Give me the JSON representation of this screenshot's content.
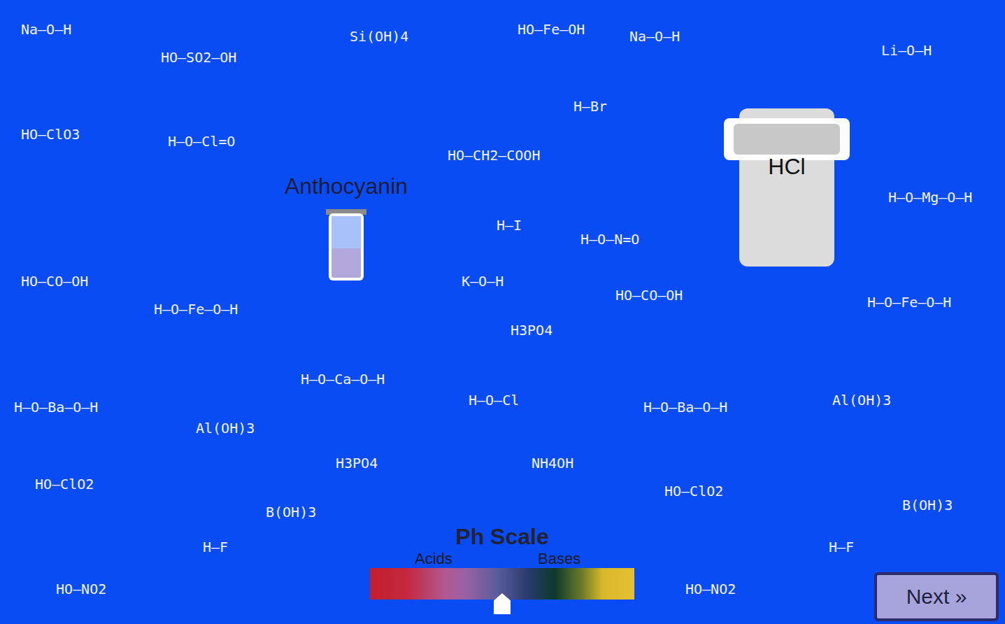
{
  "background_molecules": [
    "Na–O–H",
    "HO–SO2–OH",
    "Si(OH)4",
    "HO–Fe–OH",
    "Na–O–H",
    "Li–O–H",
    "HO–ClO3",
    "H–O–Cl=O",
    "HO–CH2–COOH",
    "H–Br",
    "H–I",
    "H–O–N=O",
    "HO–CO–OH",
    "H–O–Fe–O–H",
    "K–O–H",
    "H3PO4",
    "HO–CO–OH",
    "H–O–Fe–O–H",
    "H–O–Mg–O–H",
    "H–O–Ba–O–H",
    "Al(OH)3",
    "H–O–Ca–O–H",
    "H–O–Cl",
    "H–O–Ba–O–H",
    "Al(OH)3",
    "HO–ClO2",
    "H3PO4",
    "NH4OH",
    "HO–ClO2",
    "H–F",
    "B(OH)3",
    "H–F",
    "B(OH)3",
    "HO–NO2",
    "HO–NO2"
  ],
  "indicator": {
    "label": "Anthocyanin",
    "color": "#b3a8dc"
  },
  "beaker": {
    "label": "HCl"
  },
  "ph_scale": {
    "title": "Ph Scale",
    "left_label": "Acids",
    "right_label": "Bases",
    "level": 0.5
  },
  "buttons": [
    {
      "label": "Next »"
    }
  ]
}
